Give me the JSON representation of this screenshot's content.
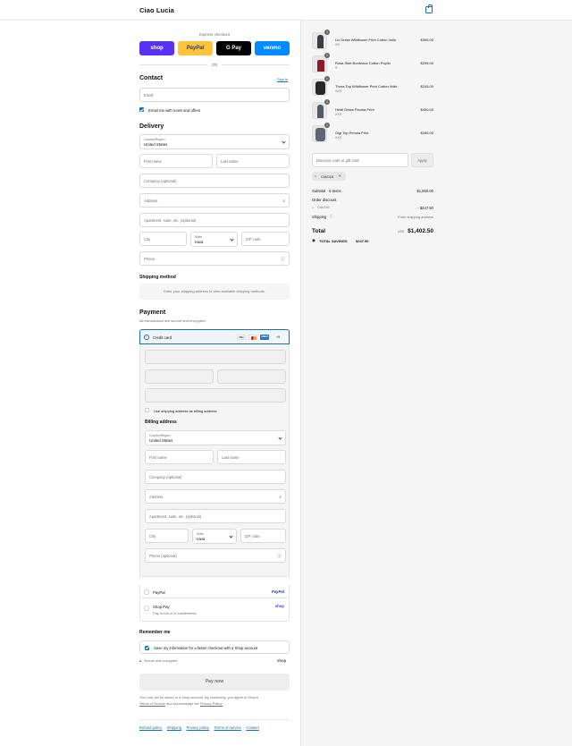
{
  "header": {
    "brand": "Ciao Lucia",
    "cart_icon": "shopping-bag-icon"
  },
  "express": {
    "label": "Express checkout",
    "buttons": [
      {
        "label": "shop",
        "color": "#5a31f4"
      },
      {
        "label": "PayPal",
        "color": "#ffc439"
      },
      {
        "label": "G Pay",
        "color": "#000000"
      },
      {
        "label": "venmo",
        "color": "#008cff"
      }
    ],
    "or": "OR"
  },
  "contact": {
    "title": "Contact",
    "sign_in": "Sign in",
    "email_placeholder": "Email",
    "news_label": "Email me with news and offers"
  },
  "delivery": {
    "title": "Delivery",
    "country_label": "Country/Region",
    "country_value": "United States",
    "first_name": "First name",
    "last_name": "Last name",
    "company": "Company (optional)",
    "address": "Address",
    "apartment": "Apartment, suite, etc. (optional)",
    "city": "City",
    "state_label": "State",
    "state_value": "Iowa",
    "zip": "ZIP code",
    "phone": "Phone"
  },
  "shipping": {
    "title": "Shipping method",
    "message": "Enter your shipping address to view available shipping methods."
  },
  "payment": {
    "title": "Payment",
    "subtitle": "All transactions are secure and encrypted.",
    "credit_card_label": "Credit card",
    "cards": [
      "VISA",
      "MC",
      "AMEX",
      "+5"
    ],
    "use_shipping_label": "Use shipping address as billing address",
    "paypal_label": "PayPal",
    "paypal_logo": "PayPal",
    "shoppay_label": "Shop Pay",
    "shoppay_sub": "Pay in full or in installments",
    "shoppay_logo": "shop"
  },
  "billing": {
    "title": "Billing address",
    "country_label": "Country/Region",
    "country_value": "United States",
    "first_name": "First name",
    "last_name": "Last name",
    "company": "Company (optional)",
    "address": "Address",
    "apartment": "Apartment, suite, etc. (optional)",
    "city": "City",
    "state_label": "State",
    "state_value": "Iowa",
    "zip": "ZIP code",
    "phone": "Phone (optional)"
  },
  "remember": {
    "title": "Remember me",
    "save_label": "Save my information for a faster checkout with a Shop account",
    "secure": "Secure and encrypted",
    "shop_logo": "shop"
  },
  "pay_button": "Pay now",
  "legal": {
    "text1": "Your info will be saved to a Shop account. By continuing, you agree to Shop's",
    "terms": "Terms of Service",
    "and": "and acknowledge the",
    "privacy": "Privacy Policy."
  },
  "footer_links": [
    "Refund policy",
    "Shipping",
    "Privacy policy",
    "Terms of service",
    "Contact"
  ],
  "cart": {
    "items": [
      {
        "name": "Liv Dress Wildflower Print Cotton Voile",
        "variant": "XS",
        "price": "$395.00",
        "qty": "1",
        "color": "#3a3d45"
      },
      {
        "name": "Rosa Skirt Bordeaux Cotton Poplin",
        "variant": "S",
        "price": "$295.00",
        "qty": "1",
        "color": "#8a1c2a"
      },
      {
        "name": "Thora Top Wildflower Print Cotton Voile",
        "variant": "XXS",
        "price": "$245.00",
        "qty": "1",
        "color": "#262626"
      },
      {
        "name": "Heidi Dress Peonia Print",
        "variant": "XXS",
        "price": "$450.00",
        "qty": "1",
        "color": "#4f5a6b"
      },
      {
        "name": "Gigi Top Peonia Print",
        "variant": "XXS",
        "price": "$265.00",
        "qty": "1",
        "color": "#5d6672"
      }
    ],
    "discount_placeholder": "Discount code or gift card",
    "apply": "Apply",
    "code_chip": "CIAO15",
    "subtotal_label": "Subtotal · 5 items",
    "subtotal_value": "$1,650.00",
    "order_discount_label": "Order discount",
    "discount_code": "CIAO15",
    "discount_value": "- $247.50",
    "shipping_label": "Shipping",
    "shipping_value": "Enter shipping address",
    "total_label": "Total",
    "currency": "USD",
    "total_value": "$1,402.50",
    "savings_label": "TOTAL SAVINGS",
    "savings_value": "$247.50"
  }
}
